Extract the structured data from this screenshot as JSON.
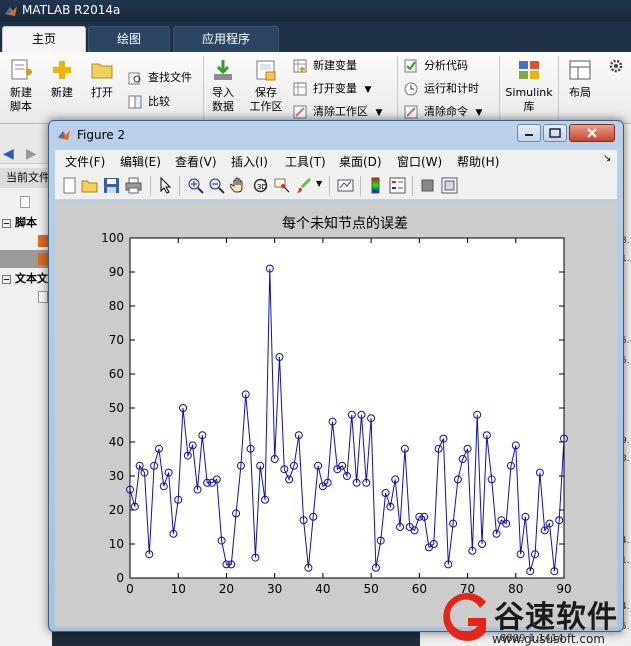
{
  "app": {
    "title": "MATLAB R2014a"
  },
  "tabs": [
    {
      "label": "主页"
    },
    {
      "label": "绘图"
    },
    {
      "label": "应用程序"
    }
  ],
  "ribbon": {
    "new_script": [
      "新建",
      "脚本"
    ],
    "new": "新建",
    "open": "打开",
    "find_files": "查找文件",
    "compare": "比较",
    "import": [
      "导入",
      "数据"
    ],
    "save_workspace": [
      "保存",
      "工作区"
    ],
    "new_variable": "新建变量",
    "open_variable": "打开变量",
    "clear_workspace": "清除工作区",
    "analyze_code": "分析代码",
    "run_and_time": "运行和计时",
    "clear_commands": "清除命令",
    "simulink": [
      "Simulink",
      "库"
    ],
    "layout": "布局"
  },
  "left_panel": {
    "current_folder": "当前文件",
    "section_scripts": "脚本",
    "section_text": "文本文"
  },
  "figure": {
    "title": "Figure 2",
    "menus": [
      "文件(F)",
      "编辑(E)",
      "查看(V)",
      "插入(I)",
      "工具(T)",
      "桌面(D)",
      "窗口(W)",
      "帮助(H)"
    ]
  },
  "chart_data": {
    "type": "line",
    "title": "每个未知节点的误差",
    "xlabel": "",
    "ylabel": "",
    "xlim": [
      0,
      90
    ],
    "ylim": [
      0,
      100
    ],
    "xticks": [
      0,
      10,
      20,
      30,
      40,
      50,
      60,
      70,
      80,
      90
    ],
    "yticks": [
      0,
      10,
      20,
      30,
      40,
      50,
      60,
      70,
      80,
      90,
      100
    ],
    "marker": "circle",
    "color": "#1010b0",
    "x": [
      0,
      1,
      2,
      3,
      4,
      5,
      6,
      7,
      8,
      9,
      10,
      11,
      12,
      13,
      14,
      15,
      16,
      17,
      18,
      19,
      20,
      21,
      22,
      23,
      24,
      25,
      26,
      27,
      28,
      29,
      30,
      31,
      32,
      33,
      34,
      35,
      36,
      37,
      38,
      39,
      40,
      41,
      42,
      43,
      44,
      45,
      46,
      47,
      48,
      49,
      50,
      51,
      52,
      53,
      54,
      55,
      56,
      57,
      58,
      59,
      60,
      61,
      62,
      63,
      64,
      65,
      66,
      67,
      68,
      69,
      70,
      71,
      72,
      73,
      74,
      75,
      76,
      77,
      78,
      79,
      80,
      81,
      82,
      83,
      84,
      85,
      86,
      87,
      88,
      89,
      90
    ],
    "y": [
      26,
      21,
      33,
      31,
      7,
      33,
      38,
      27,
      31,
      13,
      23,
      50,
      36,
      39,
      26,
      42,
      28,
      28,
      29,
      11,
      4,
      4,
      19,
      33,
      54,
      38,
      6,
      33,
      23,
      91,
      35,
      65,
      32,
      29,
      33,
      42,
      17,
      3,
      18,
      33,
      27,
      28,
      46,
      32,
      33,
      30,
      48,
      28,
      48,
      28,
      47,
      3,
      11,
      25,
      21,
      29,
      15,
      38,
      15,
      14,
      18,
      18,
      9,
      10,
      38,
      41,
      4,
      16,
      29,
      35,
      38,
      8,
      48,
      10,
      42,
      29,
      13,
      17,
      16,
      33,
      39,
      7,
      18,
      2,
      7,
      31,
      14,
      16,
      2,
      17,
      41
    ]
  },
  "right_strip": {
    "numbers": [
      "8.",
      "1.",
      "5.",
      "5.",
      "9.",
      "8.",
      "4.",
      "1.",
      "4.",
      "5."
    ]
  },
  "bottom_strip": {
    "text": "8809   1.1414"
  },
  "watermark": {
    "text": "谷速软件",
    "url": "www.gususoft.com"
  }
}
